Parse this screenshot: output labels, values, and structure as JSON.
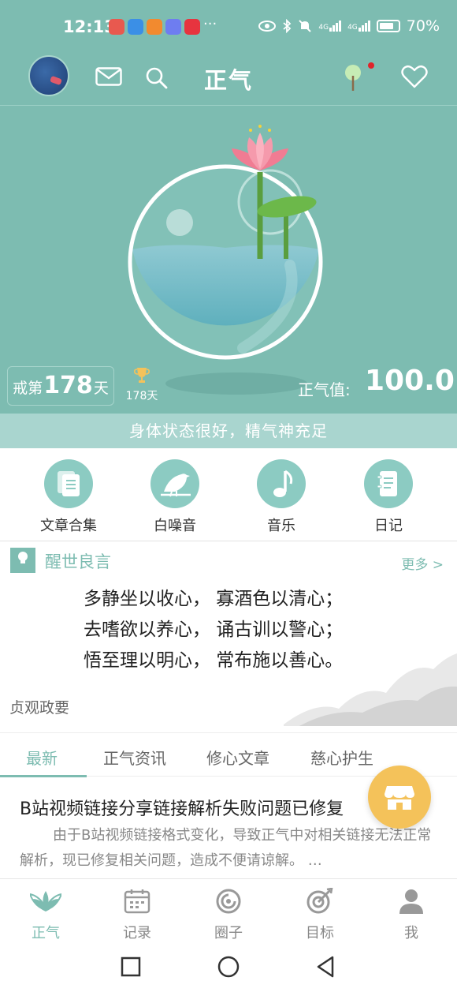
{
  "status": {
    "time": "12:13",
    "more": "···",
    "battery": "70%",
    "net1": "4G",
    "net2": "4G"
  },
  "header": {
    "title": "正气"
  },
  "hero": {
    "day_prefix": "戒第",
    "day_count": "178",
    "day_suffix": "天",
    "trophy_days": "178天",
    "zhengqi_label": "正气值:",
    "zhengqi_value": "100.0",
    "body_status": "身体状态很好，精气神充足"
  },
  "tools": [
    {
      "label": "文章合集",
      "icon": "document-icon"
    },
    {
      "label": "白噪音",
      "icon": "bird-icon"
    },
    {
      "label": "音乐",
      "icon": "music-note-icon"
    },
    {
      "label": "日记",
      "icon": "notebook-icon"
    }
  ],
  "quote": {
    "title": "醒世良言",
    "more": "更多 >",
    "lines": [
      "多静坐以收心，  寡酒色以清心；",
      "去嗜欲以养心，  诵古训以警心；",
      "悟至理以明心，  常布施以善心。"
    ],
    "source": "贞观政要"
  },
  "tabs": [
    "最新",
    "正气资讯",
    "修心文章",
    "慈心护生"
  ],
  "article": {
    "title": "B站视频链接分享链接解析失败问题已修复",
    "summary": "由于B站视频链接格式变化，导致正气中对相关链接无法正常解析，现已修复相关问题，造成不便请谅解。 …"
  },
  "bottom_nav": [
    {
      "label": "正气",
      "icon": "lotus-icon",
      "active": true
    },
    {
      "label": "记录",
      "icon": "calendar-icon",
      "active": false
    },
    {
      "label": "圈子",
      "icon": "circle-icon",
      "active": false
    },
    {
      "label": "目标",
      "icon": "target-icon",
      "active": false
    },
    {
      "label": "我",
      "icon": "person-icon",
      "active": false
    }
  ],
  "colors": {
    "primary": "#7dbcb1",
    "accent": "#f4c25a"
  }
}
